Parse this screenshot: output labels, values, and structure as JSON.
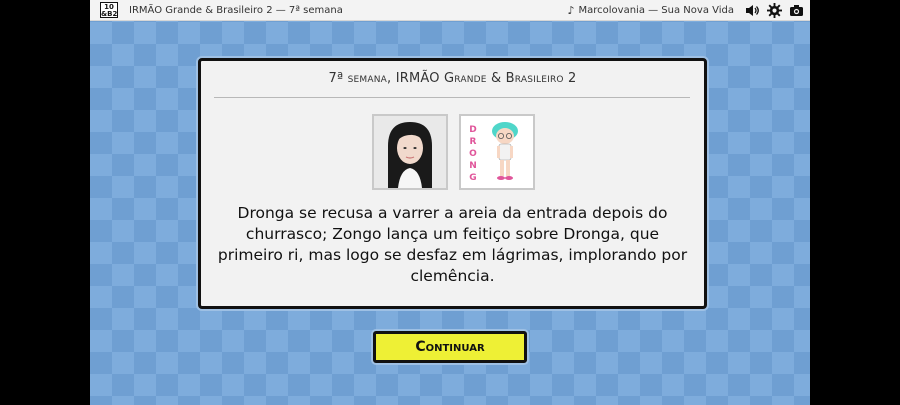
{
  "topbar": {
    "logo_text": "10\n&B2",
    "title": "IRMÃO Grande & Brasileiro 2 — 7ª semana",
    "music_track": "Marcolovania — Sua Nova Vida",
    "icons": [
      "music-note-icon",
      "speaker-icon",
      "gear-icon",
      "camera-icon"
    ]
  },
  "dialog": {
    "title": "7ª semana, IRMÃO Grande & Brasileiro 2",
    "avatars": [
      {
        "name_label": ""
      },
      {
        "name_label": "DRONGA"
      }
    ],
    "event_text": "Dronga se recusa a varrer a areia da entrada depois do churrasco; Zongo lança um feitiço sobre Dronga, que primeiro ri, mas logo se desfaz em lágrimas, implorando por clemência."
  },
  "actions": {
    "continue_label": "Continuar",
    "continue_color": "#eef035"
  }
}
